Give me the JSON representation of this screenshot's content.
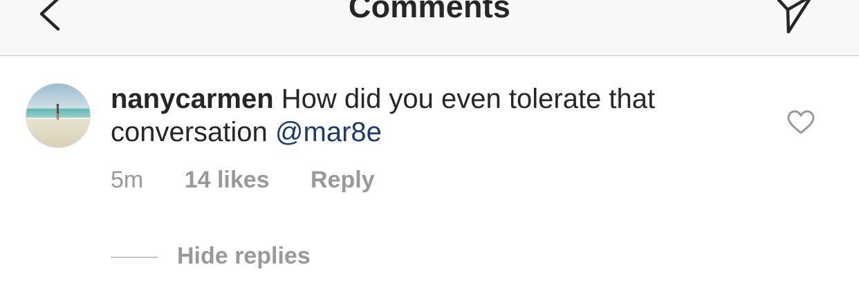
{
  "header": {
    "title": "Comments",
    "back_icon": "chevron-left-icon",
    "send_icon": "paper-plane-icon"
  },
  "comment": {
    "username": "nanycarmen",
    "text": "How did you even tolerate that conversation",
    "mention": "@mar8e",
    "time": "5m",
    "likes": "14 likes",
    "reply_label": "Reply",
    "like_icon": "heart-outline-icon"
  },
  "replies": {
    "toggle_label": "Hide replies"
  },
  "colors": {
    "header_bg": "#f8f8f8",
    "text": "#262626",
    "muted": "#999999",
    "mention": "#1f3a6b",
    "divider": "#c8c8c8"
  }
}
